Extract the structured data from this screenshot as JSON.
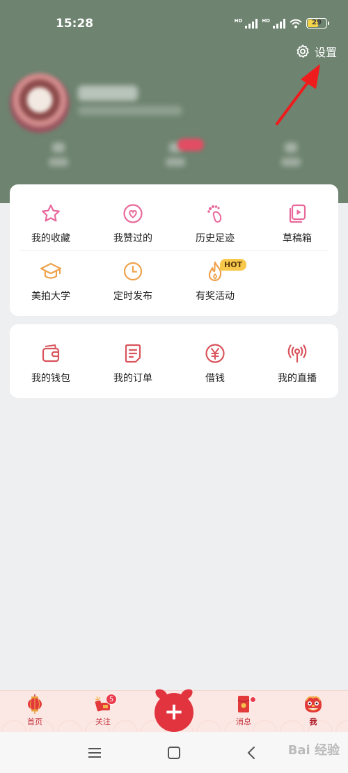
{
  "status": {
    "time": "15:28",
    "battery": "29",
    "network": "HD"
  },
  "header": {
    "settings_label": "设置"
  },
  "card1": {
    "items": [
      {
        "label": "我的收藏",
        "icon": "star-icon"
      },
      {
        "label": "我赞过的",
        "icon": "heart-icon"
      },
      {
        "label": "历史足迹",
        "icon": "footprint-icon"
      },
      {
        "label": "草稿箱",
        "icon": "draft-box-icon"
      },
      {
        "label": "美拍大学",
        "icon": "graduation-cap-icon"
      },
      {
        "label": "定时发布",
        "icon": "clock-icon"
      },
      {
        "label": "有奖活动",
        "icon": "flame-icon"
      }
    ],
    "hot_badge": "HOT"
  },
  "card2": {
    "items": [
      {
        "label": "我的钱包",
        "icon": "wallet-icon"
      },
      {
        "label": "我的订单",
        "icon": "order-icon"
      },
      {
        "label": "借钱",
        "icon": "yen-icon"
      },
      {
        "label": "我的直播",
        "icon": "broadcast-icon"
      }
    ]
  },
  "bottom_nav": {
    "items": [
      {
        "label": "首页",
        "icon": "lantern-icon"
      },
      {
        "label": "关注",
        "icon": "firecracker-icon",
        "badge": "5"
      },
      {
        "label": "消息",
        "icon": "red-envelope-icon"
      },
      {
        "label": "我",
        "icon": "lion-head-icon",
        "active": true
      }
    ],
    "center_label": "+"
  },
  "watermark": "Bai 经验",
  "colors": {
    "header_bg": "#6e8370",
    "icon_pink": "#e8699b",
    "icon_orange": "#eea24c",
    "icon_red": "#d9545c",
    "accent_red": "#e1343f"
  }
}
